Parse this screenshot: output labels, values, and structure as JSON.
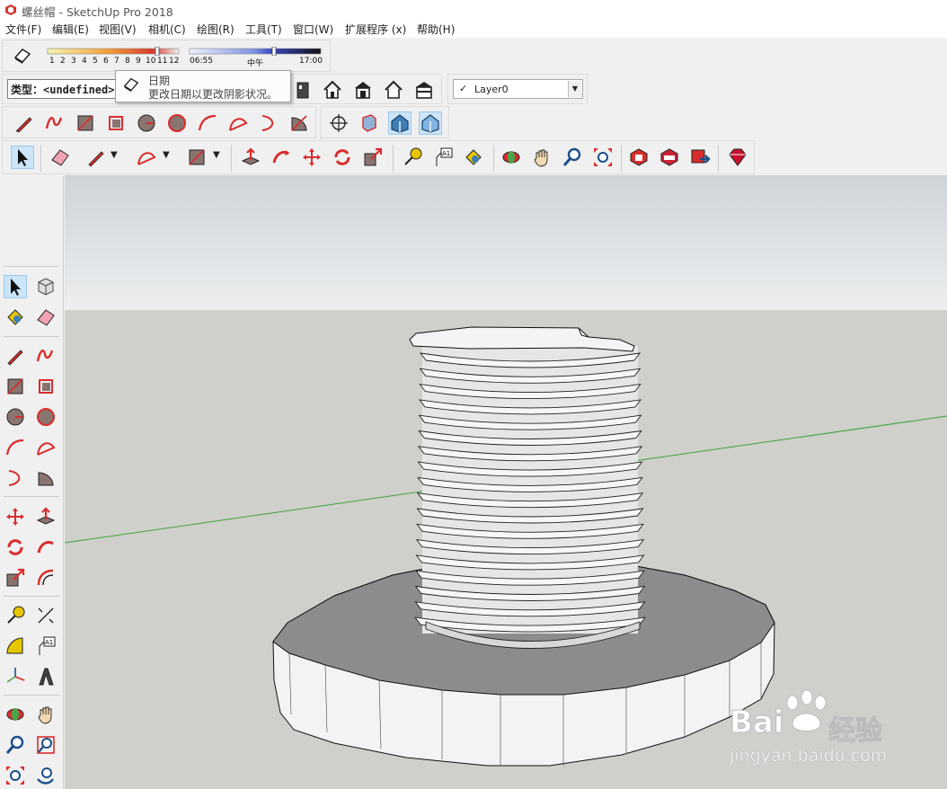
{
  "window": {
    "title": "螺丝帽 - SketchUp Pro 2018",
    "app_icon": "sketchup-logo-icon"
  },
  "menu": [
    {
      "label": "文件(F)"
    },
    {
      "label": "编辑(E)"
    },
    {
      "label": "视图(V)"
    },
    {
      "label": "相机(C)"
    },
    {
      "label": "绘图(R)"
    },
    {
      "label": "工具(T)"
    },
    {
      "label": "窗口(W)"
    },
    {
      "label": "扩展程序 (x)"
    },
    {
      "label": "帮助(H)"
    }
  ],
  "shadows": {
    "months": [
      "1",
      "2",
      "3",
      "4",
      "5",
      "6",
      "7",
      "8",
      "9",
      "10",
      "11",
      "12"
    ],
    "time_start": "06:55",
    "time_mid": "中午",
    "time_end": "17:00"
  },
  "entity_info": {
    "type_label": "类型：<undefined>"
  },
  "tooltip": {
    "title": "日期",
    "description": "更改日期以更改阴影状况。"
  },
  "layer": {
    "check": "✓",
    "name": "Layer0"
  },
  "watermark": {
    "brand_left": "Bai",
    "brand_right": "经验",
    "url": "jingyan.baidu.com"
  },
  "colors": {
    "axis_green": "#3aa63a",
    "sky": "#dde2e6",
    "ground": "#cfcfcb",
    "selection_blue": "#cce4f7"
  }
}
